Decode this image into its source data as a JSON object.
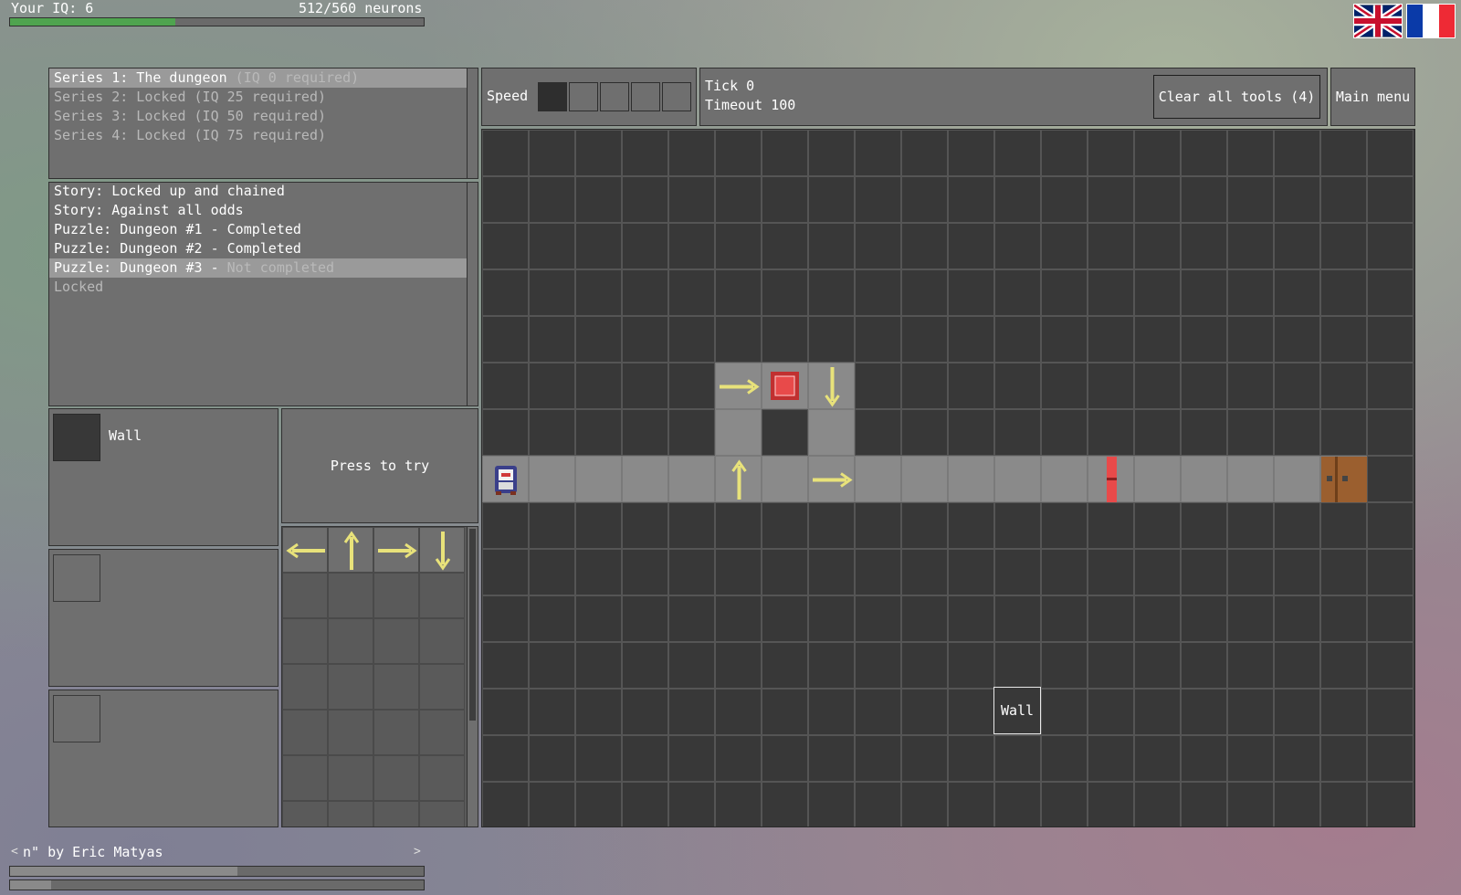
{
  "header": {
    "iq_label": "Your IQ: 6",
    "neurons_label": "512/560 neurons",
    "neuron_progress": 0.4
  },
  "flags": {
    "english": "uk-flag-icon",
    "french": "france-flag-icon"
  },
  "series": [
    {
      "label": "Series 1:",
      "name": " The dungeon",
      "req": " (IQ 0 required)",
      "selected": true
    },
    {
      "label": "Series 2:",
      "name": " Locked",
      "req": " (IQ 25 required)",
      "selected": false
    },
    {
      "label": "Series 3:",
      "name": " Locked",
      "req": " (IQ 50 required)",
      "selected": false
    },
    {
      "label": "Series 4:",
      "name": " Locked",
      "req": " (IQ 75 required)",
      "selected": false
    }
  ],
  "levels": [
    {
      "text": "Story: Locked up and chained",
      "status": ""
    },
    {
      "text": "Story: Against all odds",
      "status": ""
    },
    {
      "text": "Puzzle: Dungeon #1 - Completed",
      "status": ""
    },
    {
      "text": "Puzzle: Dungeon #2 - Completed",
      "status": ""
    },
    {
      "text": "Puzzle: Dungeon #3 - ",
      "status": "Not completed"
    },
    {
      "text": "",
      "status": "Locked"
    }
  ],
  "tools": {
    "wall_label": "Wall",
    "press_to_try": "Press to try"
  },
  "toolbar": {
    "speed_label": "Speed",
    "speed_level": 1,
    "speed_max": 5,
    "tick_label": "Tick 0",
    "timeout_label": "Timeout 100",
    "clear_label": "Clear all tools (4)",
    "main_menu_label": "Main menu"
  },
  "board": {
    "tooltip": "Wall"
  },
  "music": {
    "prev": "<",
    "next": ">",
    "track": "n\" by Eric Matyas",
    "progress": 0.55,
    "volume": 0.1
  },
  "colors": {
    "floor": "#8a8a8a",
    "wall": "#383838",
    "arrow": "#e8e27a",
    "red": "#e84a4a",
    "door": "#9b5f2f"
  }
}
